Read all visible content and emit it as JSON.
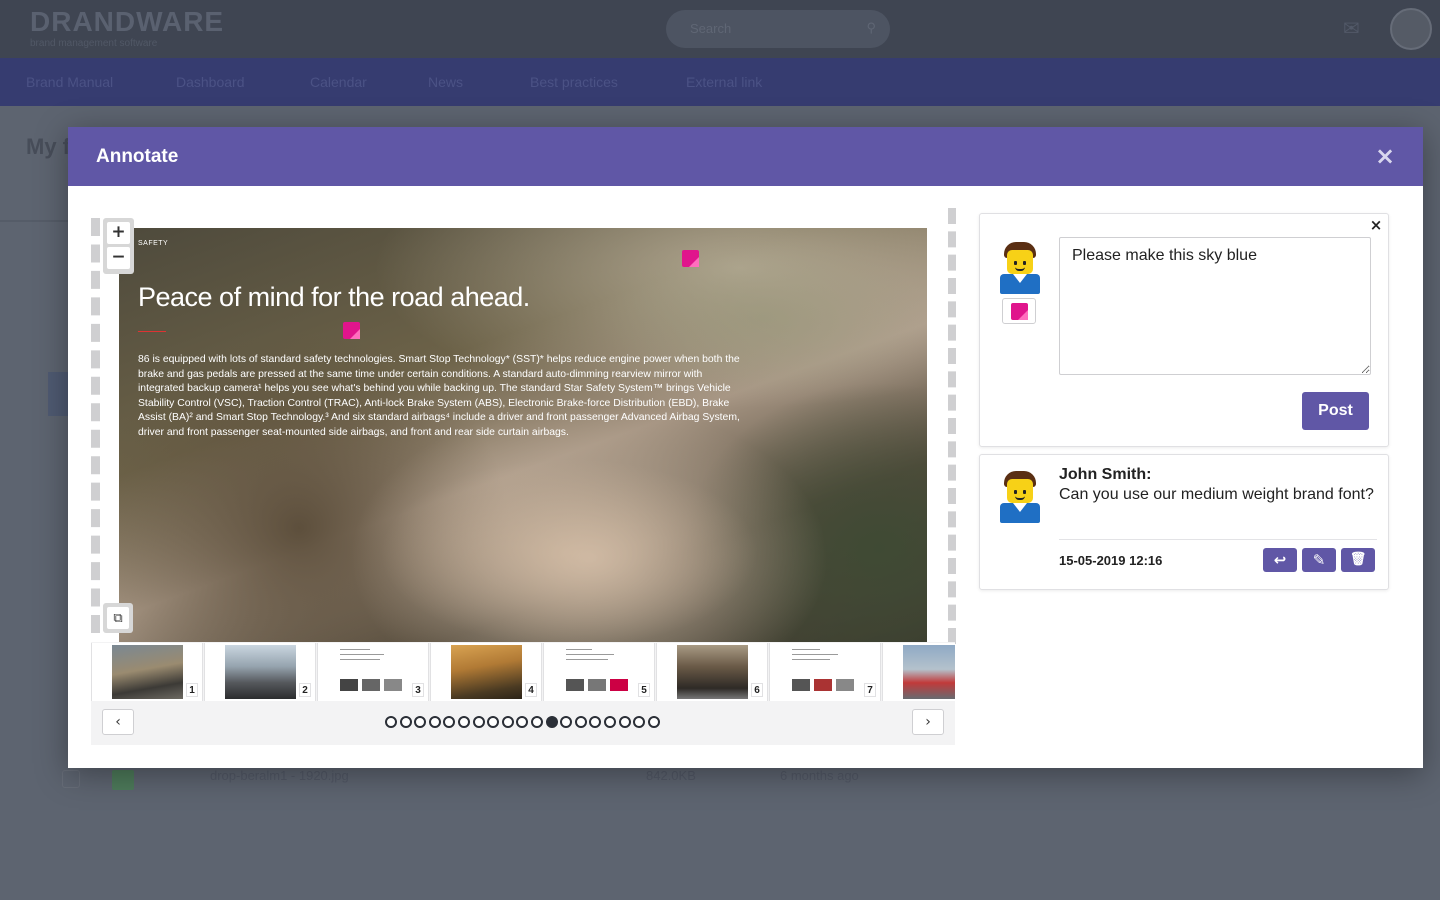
{
  "background": {
    "logo": "DRANDWARE",
    "logo_sub": "brand management software",
    "search_placeholder": "Search",
    "nav_items": [
      "Brand Manual",
      "Dashboard",
      "Calendar",
      "News",
      "Best practices",
      "External link"
    ],
    "page_title": "My f",
    "row": {
      "name": "drop-beralm1 - 1920.jpg",
      "size": "842.0KB",
      "age": "6 months ago"
    }
  },
  "modal": {
    "title": "Annotate",
    "close_icon": "×"
  },
  "viewer": {
    "zoom_in": "+",
    "zoom_out": "−",
    "copy_icon": "⧉",
    "page": {
      "kicker": "SAFETY",
      "headline": "Peace of mind for the road ahead.",
      "body": "86 is equipped with lots of standard safety technologies. Smart Stop Technology* (SST)* helps reduce engine power when both the brake and gas pedals are pressed at the same time under certain conditions. A standard auto-dimming rearview mirror with integrated backup camera¹ helps you see what's behind you while backing up. The standard Star Safety System™ brings Vehicle Stability Control (VSC), Traction Control (TRAC), Anti-lock Brake System (ABS), Electronic Brake-force Distribution (EBD), Brake Assist (BA)² and Smart Stop Technology.³ And six standard airbags⁴ include a driver and front passenger Advanced Airbag System, driver and front passenger seat-mounted side airbags, and front and rear side curtain airbags."
    },
    "thumbnails": [
      {
        "num": "1",
        "style": "tp-photo"
      },
      {
        "num": "2",
        "style": "tp-photo2"
      },
      {
        "num": "3",
        "style": "tp-doc"
      },
      {
        "num": "4",
        "style": "tp-sunset"
      },
      {
        "num": "5",
        "style": "tp-doc"
      },
      {
        "num": "6",
        "style": "tp-road"
      },
      {
        "num": "7",
        "style": "tp-doc"
      },
      {
        "num": "",
        "style": "tp-red"
      }
    ],
    "prev_label": "‹",
    "next_label": "›",
    "dot_count": 19,
    "active_dot": 11
  },
  "new_comment": {
    "close_icon": "×",
    "value": "Please make this sky blue",
    "post_label": "Post"
  },
  "comments": [
    {
      "author": "John Smith:",
      "text": "Can you use our medium weight brand font?",
      "date": "15-05-2019 12:16",
      "reply_icon": "↩",
      "edit_icon": "✎",
      "delete_icon": "🗑"
    }
  ],
  "colors": {
    "header": "#6057a6",
    "marker": "#e0158c"
  }
}
